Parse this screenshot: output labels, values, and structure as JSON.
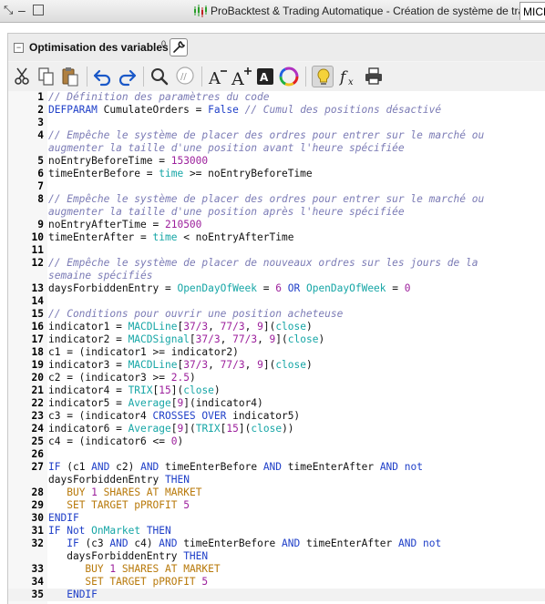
{
  "window": {
    "title": "ProBacktest & Trading Automatique - Création de système de trading",
    "tab_fragment": "MICR"
  },
  "panel": {
    "title": "Optimisation des variables",
    "count": "0"
  },
  "toolbar": {
    "buttons": [
      "cut-icon",
      "copy-icon",
      "paste-icon",
      "undo-icon",
      "redo-icon",
      "search-icon",
      "comment-icon",
      "font-decrease-icon",
      "font-increase-icon",
      "color-scheme-icon",
      "color-wheel-icon",
      "lightbulb-icon",
      "function-icon",
      "print-icon"
    ]
  },
  "colors": {
    "comment": "#7b7bb5",
    "keyword": "#1f3fc8",
    "function": "#16a6a6",
    "constant": "#9c1f9c",
    "order": "#b8790a"
  },
  "code": [
    {
      "n": "1",
      "code": [
        [
          "c",
          "// Définition des paramètres du code"
        ]
      ]
    },
    {
      "n": "2",
      "code": [
        [
          "k",
          "DEFPARAM"
        ],
        [
          "t",
          " CumulateOrders = "
        ],
        [
          "k",
          "False"
        ],
        [
          "t",
          " "
        ],
        [
          "c",
          "// Cumul des positions désactivé"
        ]
      ]
    },
    {
      "n": "3",
      "code": []
    },
    {
      "n": "4",
      "code": [
        [
          "c",
          "// Empêche le système de placer des ordres pour entrer sur le marché ou"
        ]
      ]
    },
    {
      "n": "",
      "code": [
        [
          "c",
          "augmenter la taille d'une position avant l'heure spécifiée"
        ]
      ]
    },
    {
      "n": "5",
      "code": [
        [
          "t",
          "noEntryBeforeTime = "
        ],
        [
          "v",
          "153000"
        ]
      ]
    },
    {
      "n": "6",
      "code": [
        [
          "t",
          "timeEnterBefore = "
        ],
        [
          "f",
          "time"
        ],
        [
          "t",
          " >= noEntryBeforeTime"
        ]
      ]
    },
    {
      "n": "7",
      "code": []
    },
    {
      "n": "8",
      "code": [
        [
          "c",
          "// Empêche le système de placer des ordres pour entrer sur le marché ou"
        ]
      ]
    },
    {
      "n": "",
      "code": [
        [
          "c",
          "augmenter la taille d'une position après l'heure spécifiée"
        ]
      ]
    },
    {
      "n": "9",
      "code": [
        [
          "t",
          "noEntryAfterTime = "
        ],
        [
          "v",
          "210500"
        ]
      ]
    },
    {
      "n": "10",
      "code": [
        [
          "t",
          "timeEnterAfter = "
        ],
        [
          "f",
          "time"
        ],
        [
          "t",
          " < noEntryAfterTime"
        ]
      ]
    },
    {
      "n": "11",
      "code": []
    },
    {
      "n": "12",
      "code": [
        [
          "c",
          "// Empêche le système de placer de nouveaux ordres sur les jours de la"
        ]
      ]
    },
    {
      "n": "",
      "code": [
        [
          "c",
          "semaine spécifiés"
        ]
      ]
    },
    {
      "n": "13",
      "code": [
        [
          "t",
          "daysForbiddenEntry = "
        ],
        [
          "f",
          "OpenDayOfWeek"
        ],
        [
          "t",
          " = "
        ],
        [
          "v",
          "6"
        ],
        [
          "t",
          " "
        ],
        [
          "k",
          "OR"
        ],
        [
          "t",
          " "
        ],
        [
          "f",
          "OpenDayOfWeek"
        ],
        [
          "t",
          " = "
        ],
        [
          "v",
          "0"
        ]
      ]
    },
    {
      "n": "14",
      "code": []
    },
    {
      "n": "15",
      "code": [
        [
          "c",
          "// Conditions pour ouvrir une position acheteuse"
        ]
      ]
    },
    {
      "n": "16",
      "code": [
        [
          "t",
          "indicator1 = "
        ],
        [
          "f",
          "MACDLine"
        ],
        [
          "t",
          "["
        ],
        [
          "v",
          "37/3"
        ],
        [
          "t",
          ", "
        ],
        [
          "v",
          "77/3"
        ],
        [
          "t",
          ", "
        ],
        [
          "v",
          "9"
        ],
        [
          "t",
          "]("
        ],
        [
          "f",
          "close"
        ],
        [
          "t",
          ")"
        ]
      ]
    },
    {
      "n": "17",
      "code": [
        [
          "t",
          "indicator2 = "
        ],
        [
          "f",
          "MACDSignal"
        ],
        [
          "t",
          "["
        ],
        [
          "v",
          "37/3"
        ],
        [
          "t",
          ", "
        ],
        [
          "v",
          "77/3"
        ],
        [
          "t",
          ", "
        ],
        [
          "v",
          "9"
        ],
        [
          "t",
          "]("
        ],
        [
          "f",
          "close"
        ],
        [
          "t",
          ")"
        ]
      ]
    },
    {
      "n": "18",
      "code": [
        [
          "t",
          "c1 = (indicator1 >= indicator2)"
        ]
      ]
    },
    {
      "n": "19",
      "code": [
        [
          "t",
          "indicator3 = "
        ],
        [
          "f",
          "MACDLine"
        ],
        [
          "t",
          "["
        ],
        [
          "v",
          "37/3"
        ],
        [
          "t",
          ", "
        ],
        [
          "v",
          "77/3"
        ],
        [
          "t",
          ", "
        ],
        [
          "v",
          "9"
        ],
        [
          "t",
          "]("
        ],
        [
          "f",
          "close"
        ],
        [
          "t",
          ")"
        ]
      ]
    },
    {
      "n": "20",
      "code": [
        [
          "t",
          "c2 = (indicator3 >= "
        ],
        [
          "v",
          "2.5"
        ],
        [
          "t",
          ")"
        ]
      ]
    },
    {
      "n": "21",
      "code": [
        [
          "t",
          "indicator4 = "
        ],
        [
          "f",
          "TRIX"
        ],
        [
          "t",
          "["
        ],
        [
          "v",
          "15"
        ],
        [
          "t",
          "]("
        ],
        [
          "f",
          "close"
        ],
        [
          "t",
          ")"
        ]
      ]
    },
    {
      "n": "22",
      "code": [
        [
          "t",
          "indicator5 = "
        ],
        [
          "f",
          "Average"
        ],
        [
          "t",
          "["
        ],
        [
          "v",
          "9"
        ],
        [
          "t",
          "](indicator4)"
        ]
      ]
    },
    {
      "n": "23",
      "code": [
        [
          "t",
          "c3 = (indicator4 "
        ],
        [
          "k",
          "CROSSES OVER"
        ],
        [
          "t",
          " indicator5)"
        ]
      ]
    },
    {
      "n": "24",
      "code": [
        [
          "t",
          "indicator6 = "
        ],
        [
          "f",
          "Average"
        ],
        [
          "t",
          "["
        ],
        [
          "v",
          "9"
        ],
        [
          "t",
          "]("
        ],
        [
          "f",
          "TRIX"
        ],
        [
          "t",
          "["
        ],
        [
          "v",
          "15"
        ],
        [
          "t",
          "]("
        ],
        [
          "f",
          "close"
        ],
        [
          "t",
          "))"
        ]
      ]
    },
    {
      "n": "25",
      "code": [
        [
          "t",
          "c4 = (indicator6 <= "
        ],
        [
          "v",
          "0"
        ],
        [
          "t",
          ")"
        ]
      ]
    },
    {
      "n": "26",
      "code": []
    },
    {
      "n": "27",
      "code": [
        [
          "k",
          "IF"
        ],
        [
          "t",
          " (c1 "
        ],
        [
          "k",
          "AND"
        ],
        [
          "t",
          " c2) "
        ],
        [
          "k",
          "AND"
        ],
        [
          "t",
          " timeEnterBefore "
        ],
        [
          "k",
          "AND"
        ],
        [
          "t",
          " timeEnterAfter "
        ],
        [
          "k",
          "AND"
        ],
        [
          "t",
          " "
        ],
        [
          "k",
          "not"
        ]
      ]
    },
    {
      "n": "",
      "code": [
        [
          "t",
          "daysForbiddenEntry "
        ],
        [
          "k",
          "THEN"
        ]
      ]
    },
    {
      "n": "28",
      "code": [
        [
          "t",
          "   "
        ],
        [
          "o",
          "BUY "
        ],
        [
          "v",
          "1"
        ],
        [
          "o",
          " SHARES AT MARKET"
        ]
      ]
    },
    {
      "n": "29",
      "code": [
        [
          "t",
          "   "
        ],
        [
          "o",
          "SET TARGET pPROFIT "
        ],
        [
          "v",
          "5"
        ]
      ]
    },
    {
      "n": "30",
      "code": [
        [
          "k",
          "ENDIF"
        ]
      ]
    },
    {
      "n": "31",
      "code": [
        [
          "k",
          "IF Not"
        ],
        [
          "t",
          " "
        ],
        [
          "f",
          "OnMarket"
        ],
        [
          "t",
          " "
        ],
        [
          "k",
          "THEN"
        ]
      ]
    },
    {
      "n": "32",
      "code": [
        [
          "t",
          "   "
        ],
        [
          "k",
          "IF"
        ],
        [
          "t",
          " (c3 "
        ],
        [
          "k",
          "AND"
        ],
        [
          "t",
          " c4) "
        ],
        [
          "k",
          "AND"
        ],
        [
          "t",
          " timeEnterBefore "
        ],
        [
          "k",
          "AND"
        ],
        [
          "t",
          " timeEnterAfter "
        ],
        [
          "k",
          "AND"
        ],
        [
          "t",
          " "
        ],
        [
          "k",
          "not"
        ]
      ]
    },
    {
      "n": "",
      "code": [
        [
          "t",
          "   daysForbiddenEntry "
        ],
        [
          "k",
          "THEN"
        ]
      ]
    },
    {
      "n": "33",
      "code": [
        [
          "t",
          "      "
        ],
        [
          "o",
          "BUY "
        ],
        [
          "v",
          "1"
        ],
        [
          "o",
          " SHARES AT MARKET"
        ]
      ]
    },
    {
      "n": "34",
      "code": [
        [
          "t",
          "      "
        ],
        [
          "o",
          "SET TARGET pPROFIT "
        ],
        [
          "v",
          "5"
        ]
      ]
    },
    {
      "n": "35",
      "code": [
        [
          "t",
          "   "
        ],
        [
          "k",
          "ENDIF"
        ]
      ]
    }
  ],
  "current_line": "35"
}
